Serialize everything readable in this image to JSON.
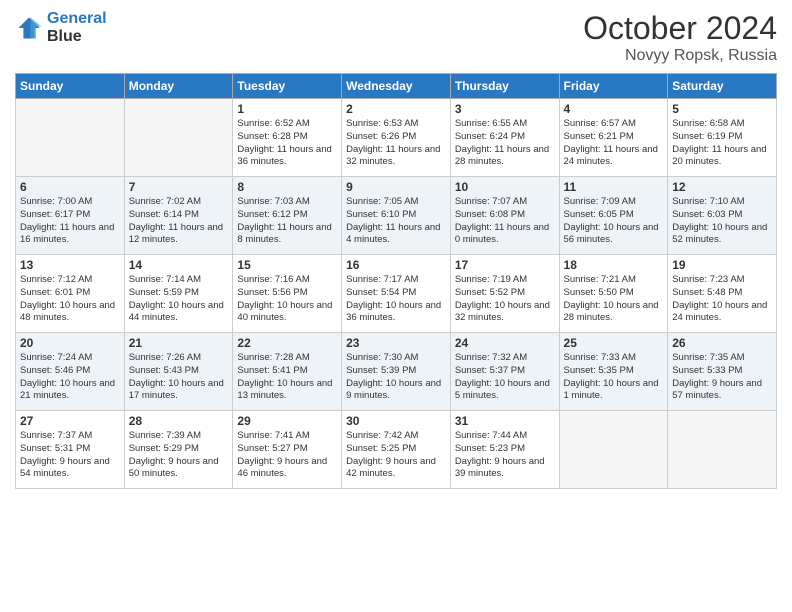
{
  "header": {
    "logo_line1": "General",
    "logo_line2": "Blue",
    "month": "October 2024",
    "location": "Novyy Ropsk, Russia"
  },
  "weekdays": [
    "Sunday",
    "Monday",
    "Tuesday",
    "Wednesday",
    "Thursday",
    "Friday",
    "Saturday"
  ],
  "weeks": [
    [
      {
        "day": "",
        "sunrise": "",
        "sunset": "",
        "daylight": ""
      },
      {
        "day": "",
        "sunrise": "",
        "sunset": "",
        "daylight": ""
      },
      {
        "day": "1",
        "sunrise": "Sunrise: 6:52 AM",
        "sunset": "Sunset: 6:28 PM",
        "daylight": "Daylight: 11 hours and 36 minutes."
      },
      {
        "day": "2",
        "sunrise": "Sunrise: 6:53 AM",
        "sunset": "Sunset: 6:26 PM",
        "daylight": "Daylight: 11 hours and 32 minutes."
      },
      {
        "day": "3",
        "sunrise": "Sunrise: 6:55 AM",
        "sunset": "Sunset: 6:24 PM",
        "daylight": "Daylight: 11 hours and 28 minutes."
      },
      {
        "day": "4",
        "sunrise": "Sunrise: 6:57 AM",
        "sunset": "Sunset: 6:21 PM",
        "daylight": "Daylight: 11 hours and 24 minutes."
      },
      {
        "day": "5",
        "sunrise": "Sunrise: 6:58 AM",
        "sunset": "Sunset: 6:19 PM",
        "daylight": "Daylight: 11 hours and 20 minutes."
      }
    ],
    [
      {
        "day": "6",
        "sunrise": "Sunrise: 7:00 AM",
        "sunset": "Sunset: 6:17 PM",
        "daylight": "Daylight: 11 hours and 16 minutes."
      },
      {
        "day": "7",
        "sunrise": "Sunrise: 7:02 AM",
        "sunset": "Sunset: 6:14 PM",
        "daylight": "Daylight: 11 hours and 12 minutes."
      },
      {
        "day": "8",
        "sunrise": "Sunrise: 7:03 AM",
        "sunset": "Sunset: 6:12 PM",
        "daylight": "Daylight: 11 hours and 8 minutes."
      },
      {
        "day": "9",
        "sunrise": "Sunrise: 7:05 AM",
        "sunset": "Sunset: 6:10 PM",
        "daylight": "Daylight: 11 hours and 4 minutes."
      },
      {
        "day": "10",
        "sunrise": "Sunrise: 7:07 AM",
        "sunset": "Sunset: 6:08 PM",
        "daylight": "Daylight: 11 hours and 0 minutes."
      },
      {
        "day": "11",
        "sunrise": "Sunrise: 7:09 AM",
        "sunset": "Sunset: 6:05 PM",
        "daylight": "Daylight: 10 hours and 56 minutes."
      },
      {
        "day": "12",
        "sunrise": "Sunrise: 7:10 AM",
        "sunset": "Sunset: 6:03 PM",
        "daylight": "Daylight: 10 hours and 52 minutes."
      }
    ],
    [
      {
        "day": "13",
        "sunrise": "Sunrise: 7:12 AM",
        "sunset": "Sunset: 6:01 PM",
        "daylight": "Daylight: 10 hours and 48 minutes."
      },
      {
        "day": "14",
        "sunrise": "Sunrise: 7:14 AM",
        "sunset": "Sunset: 5:59 PM",
        "daylight": "Daylight: 10 hours and 44 minutes."
      },
      {
        "day": "15",
        "sunrise": "Sunrise: 7:16 AM",
        "sunset": "Sunset: 5:56 PM",
        "daylight": "Daylight: 10 hours and 40 minutes."
      },
      {
        "day": "16",
        "sunrise": "Sunrise: 7:17 AM",
        "sunset": "Sunset: 5:54 PM",
        "daylight": "Daylight: 10 hours and 36 minutes."
      },
      {
        "day": "17",
        "sunrise": "Sunrise: 7:19 AM",
        "sunset": "Sunset: 5:52 PM",
        "daylight": "Daylight: 10 hours and 32 minutes."
      },
      {
        "day": "18",
        "sunrise": "Sunrise: 7:21 AM",
        "sunset": "Sunset: 5:50 PM",
        "daylight": "Daylight: 10 hours and 28 minutes."
      },
      {
        "day": "19",
        "sunrise": "Sunrise: 7:23 AM",
        "sunset": "Sunset: 5:48 PM",
        "daylight": "Daylight: 10 hours and 24 minutes."
      }
    ],
    [
      {
        "day": "20",
        "sunrise": "Sunrise: 7:24 AM",
        "sunset": "Sunset: 5:46 PM",
        "daylight": "Daylight: 10 hours and 21 minutes."
      },
      {
        "day": "21",
        "sunrise": "Sunrise: 7:26 AM",
        "sunset": "Sunset: 5:43 PM",
        "daylight": "Daylight: 10 hours and 17 minutes."
      },
      {
        "day": "22",
        "sunrise": "Sunrise: 7:28 AM",
        "sunset": "Sunset: 5:41 PM",
        "daylight": "Daylight: 10 hours and 13 minutes."
      },
      {
        "day": "23",
        "sunrise": "Sunrise: 7:30 AM",
        "sunset": "Sunset: 5:39 PM",
        "daylight": "Daylight: 10 hours and 9 minutes."
      },
      {
        "day": "24",
        "sunrise": "Sunrise: 7:32 AM",
        "sunset": "Sunset: 5:37 PM",
        "daylight": "Daylight: 10 hours and 5 minutes."
      },
      {
        "day": "25",
        "sunrise": "Sunrise: 7:33 AM",
        "sunset": "Sunset: 5:35 PM",
        "daylight": "Daylight: 10 hours and 1 minute."
      },
      {
        "day": "26",
        "sunrise": "Sunrise: 7:35 AM",
        "sunset": "Sunset: 5:33 PM",
        "daylight": "Daylight: 9 hours and 57 minutes."
      }
    ],
    [
      {
        "day": "27",
        "sunrise": "Sunrise: 7:37 AM",
        "sunset": "Sunset: 5:31 PM",
        "daylight": "Daylight: 9 hours and 54 minutes."
      },
      {
        "day": "28",
        "sunrise": "Sunrise: 7:39 AM",
        "sunset": "Sunset: 5:29 PM",
        "daylight": "Daylight: 9 hours and 50 minutes."
      },
      {
        "day": "29",
        "sunrise": "Sunrise: 7:41 AM",
        "sunset": "Sunset: 5:27 PM",
        "daylight": "Daylight: 9 hours and 46 minutes."
      },
      {
        "day": "30",
        "sunrise": "Sunrise: 7:42 AM",
        "sunset": "Sunset: 5:25 PM",
        "daylight": "Daylight: 9 hours and 42 minutes."
      },
      {
        "day": "31",
        "sunrise": "Sunrise: 7:44 AM",
        "sunset": "Sunset: 5:23 PM",
        "daylight": "Daylight: 9 hours and 39 minutes."
      },
      {
        "day": "",
        "sunrise": "",
        "sunset": "",
        "daylight": ""
      },
      {
        "day": "",
        "sunrise": "",
        "sunset": "",
        "daylight": ""
      }
    ]
  ]
}
